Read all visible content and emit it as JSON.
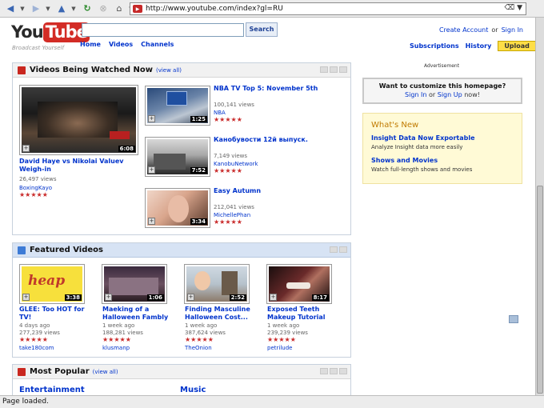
{
  "browser": {
    "url": "http://www.youtube.com/index?gl=RU",
    "status": "Page loaded."
  },
  "header": {
    "logo_you": "You",
    "logo_tube": "Tube",
    "tagline": "Broadcast Yourself",
    "search_label": "Search",
    "nav": [
      "Home",
      "Videos",
      "Channels"
    ],
    "create_account": "Create Account",
    "or": "or",
    "sign_in": "Sign In",
    "subscriptions": "Subscriptions",
    "history": "History",
    "upload": "Upload"
  },
  "watched": {
    "title": "Videos Being Watched Now",
    "view_all": "(view all)",
    "featured_video": {
      "title": "David Haye vs Nikolai Valuev Weigh-in",
      "views": "26,497 views",
      "user": "BoxingKayo",
      "duration": "6:08",
      "stars": "★★★★★"
    },
    "side_videos": [
      {
        "title": "NBA TV Top 5: November 5th",
        "views": "100,141 views",
        "user": "NBA",
        "duration": "1:25",
        "stars": "★★★★★"
      },
      {
        "title": "Канобувости 12й выпуск.",
        "views": "7,149 views",
        "user": "KanobuNetwork",
        "duration": "7:52",
        "stars": "★★★★★"
      },
      {
        "title": "Easy Autumn",
        "views": "212,041 views",
        "user": "MichellePhan",
        "duration": "3:34",
        "stars": "★★★★★"
      }
    ]
  },
  "featured": {
    "title": "Featured Videos",
    "videos": [
      {
        "title": "GLEE: Too HOT for TV!",
        "age": "4 days ago",
        "views": "277,239 views",
        "user": "take180com",
        "duration": "3:38",
        "stars": "★★★★★"
      },
      {
        "title": "Maeking of a Halloween Fambly",
        "age": "1 week ago",
        "views": "188,281 views",
        "user": "klusmanp",
        "duration": "1:06",
        "stars": "★★★★★"
      },
      {
        "title": "Finding Masculine Halloween Cost...",
        "age": "1 week ago",
        "views": "387,624 views",
        "user": "TheOnion",
        "duration": "2:52",
        "stars": "★★★★★"
      },
      {
        "title": "Exposed Teeth Makeup Tutorial",
        "age": "1 week ago",
        "views": "239,239 views",
        "user": "petrilude",
        "duration": "8:17",
        "stars": "★★★★★"
      }
    ]
  },
  "popular": {
    "title": "Most Popular",
    "view_all": "(view all)",
    "categories": [
      "Entertainment",
      "Music"
    ]
  },
  "sidebar": {
    "ad_label": "Advertisement",
    "customize_q": "Want to customize this homepage?",
    "sign_in": "Sign In",
    "or": "or",
    "sign_up": "Sign Up",
    "now": "now!",
    "whats_new_title": "What's New",
    "news": [
      {
        "heading": "Insight Data Now Exportable",
        "desc": "Analyze Insight data more easily"
      },
      {
        "heading": "Shows and Movies",
        "desc": "Watch full-length shows and movies"
      }
    ]
  }
}
